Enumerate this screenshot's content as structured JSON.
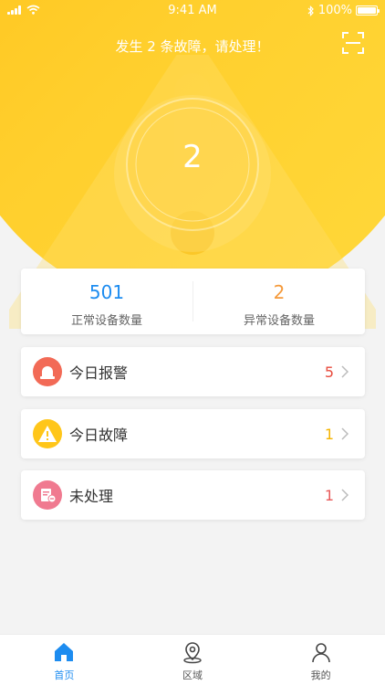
{
  "status_bar": {
    "time": "9:41 AM",
    "battery": "100%"
  },
  "header": {
    "alert_text": "发生 2 条故障，请处理！",
    "scan_icon": "scan-icon"
  },
  "summary": {
    "fault_count": "2"
  },
  "stats": [
    {
      "value": "501",
      "label": "正常设备数量",
      "color": "#1d8cf0"
    },
    {
      "value": "2",
      "label": "异常设备数量",
      "color": "#f59a3b"
    }
  ],
  "items": [
    {
      "label": "今日报警",
      "count": "5",
      "count_color": "#e84a3c",
      "icon": "alarm-light-icon"
    },
    {
      "label": "今日故障",
      "count": "1",
      "count_color": "#f5b400",
      "icon": "warning-icon"
    },
    {
      "label": "未处理",
      "count": "1",
      "count_color": "#e85a5a",
      "icon": "pending-document-icon"
    }
  ],
  "tabs": [
    {
      "label": "首页",
      "icon": "home-icon",
      "active": true
    },
    {
      "label": "区域",
      "icon": "location-pin-icon",
      "active": false
    },
    {
      "label": "我的",
      "icon": "user-icon",
      "active": false
    }
  ],
  "colors": {
    "hero": "#ffc21a",
    "accent": "#1d8cf0"
  }
}
